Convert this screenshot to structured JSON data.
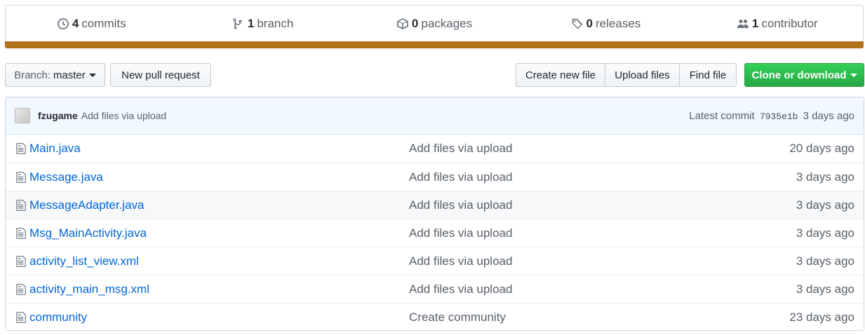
{
  "summary": {
    "commits": {
      "count": "4",
      "label": "commits",
      "icon": "history-icon"
    },
    "branches": {
      "count": "1",
      "label": "branch",
      "icon": "branch-icon"
    },
    "packages": {
      "count": "0",
      "label": "packages",
      "icon": "package-icon"
    },
    "releases": {
      "count": "0",
      "label": "releases",
      "icon": "tag-icon"
    },
    "contributors": {
      "count": "1",
      "label": "contributor",
      "icon": "people-icon"
    },
    "language_color": "#b07219"
  },
  "toolbar": {
    "branch_prefix": "Branch:",
    "branch_name": "master",
    "new_pull_request": "New pull request",
    "create_new_file": "Create new file",
    "upload_files": "Upload files",
    "find_file": "Find file",
    "clone_or_download": "Clone or download"
  },
  "latest_commit": {
    "author": "fzugame",
    "message": "Add files via upload",
    "label": "Latest commit",
    "sha": "7935e1b",
    "age": "3 days ago"
  },
  "files": [
    {
      "name": "Main.java",
      "message": "Add files via upload",
      "age": "20 days ago"
    },
    {
      "name": "Message.java",
      "message": "Add files via upload",
      "age": "3 days ago"
    },
    {
      "name": "MessageAdapter.java",
      "message": "Add files via upload",
      "age": "3 days ago"
    },
    {
      "name": "Msg_MainActivity.java",
      "message": "Add files via upload",
      "age": "3 days ago"
    },
    {
      "name": "activity_list_view.xml",
      "message": "Add files via upload",
      "age": "3 days ago"
    },
    {
      "name": "activity_main_msg.xml",
      "message": "Add files via upload",
      "age": "3 days ago"
    },
    {
      "name": "community",
      "message": "Create community",
      "age": "23 days ago"
    }
  ]
}
